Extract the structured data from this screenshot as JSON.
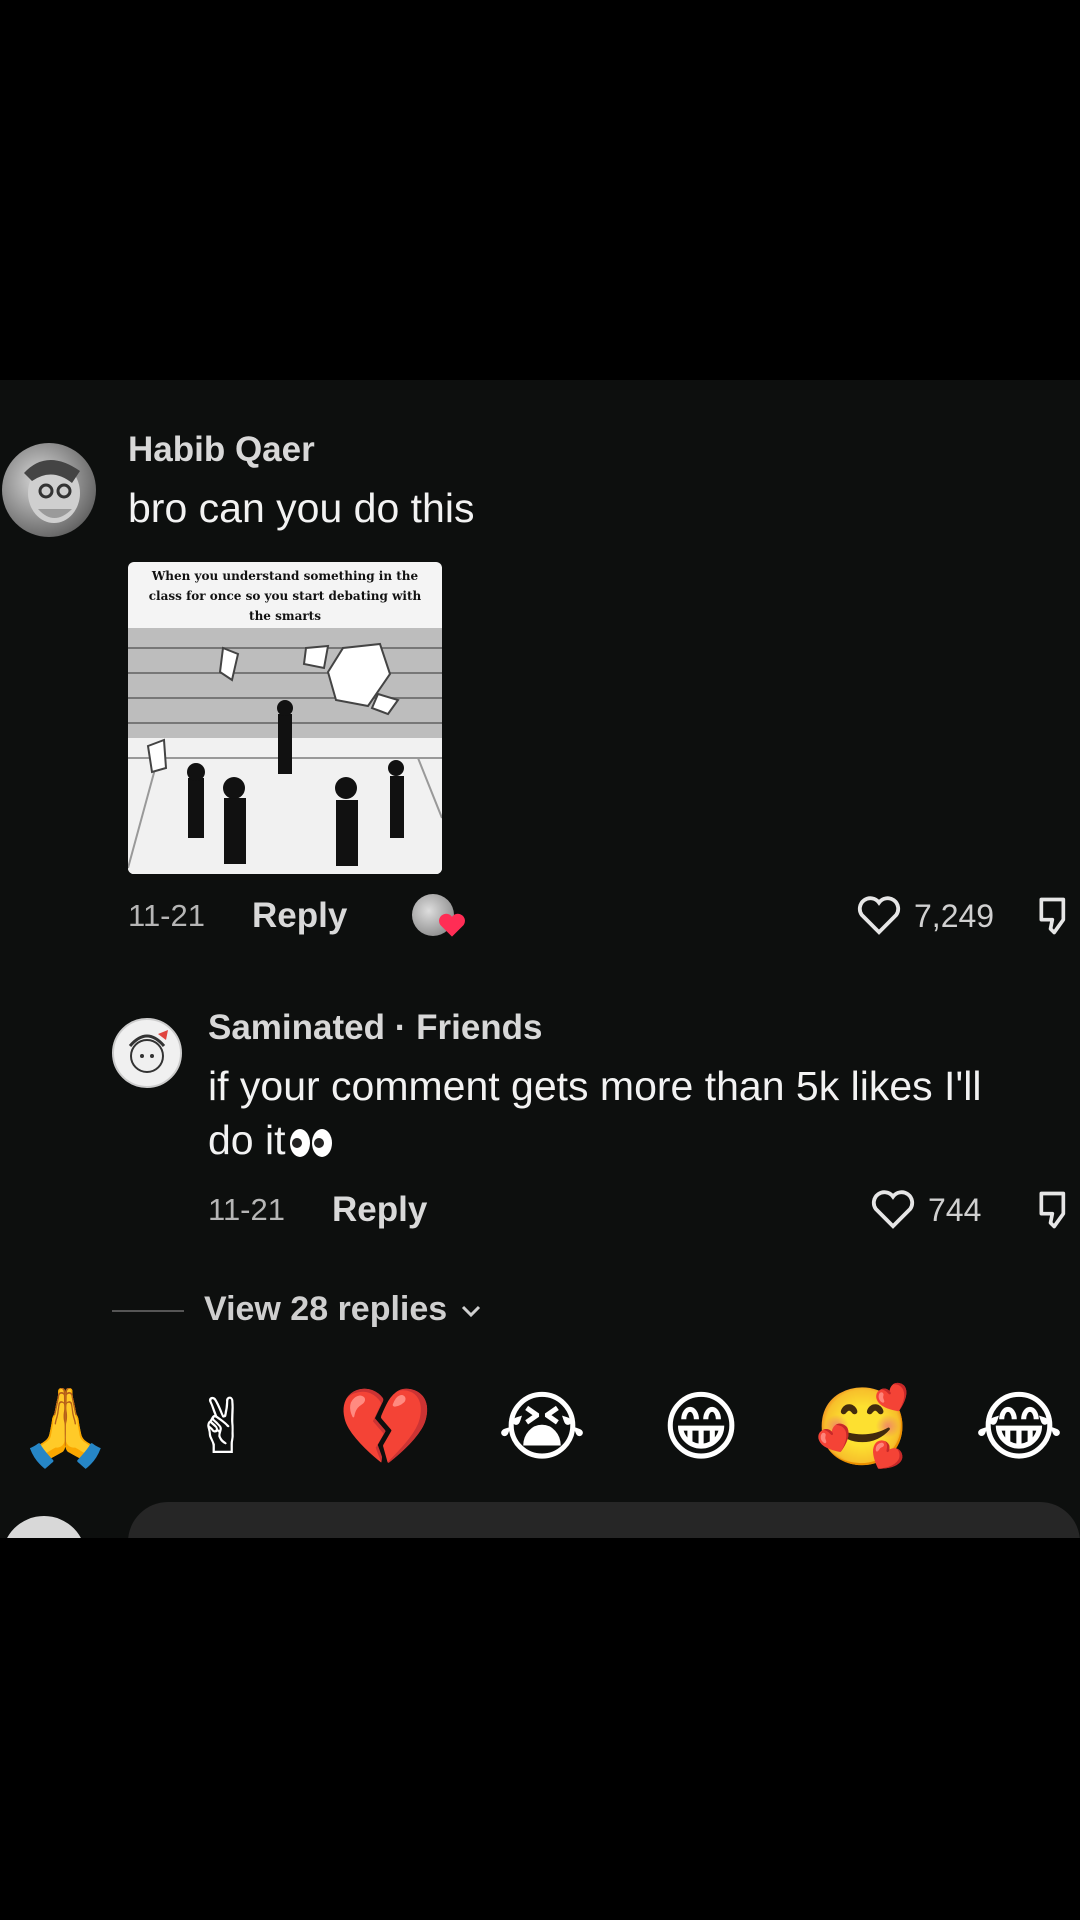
{
  "comment": {
    "author": "Habib Qaer",
    "text": "bro can you do this",
    "image_caption": "When you understand something in the class for once so you start debating with the smarts",
    "date": "11-21",
    "reply_label": "Reply",
    "likes": "7,249"
  },
  "reply_comment": {
    "author": "Saminated · Friends",
    "text_line1": "if your comment gets more than 5k likes I'll",
    "text_line2": "do it",
    "date": "11-21",
    "reply_label": "Reply",
    "likes": "744"
  },
  "view_replies": "View 28 replies",
  "emoji_bar": [
    "🙏",
    "✌",
    "💔",
    "😭",
    "😁",
    "🥰",
    "😂"
  ],
  "icons": {
    "like": "heart-outline-icon",
    "dislike": "thumbs-down-icon",
    "expand": "chevron-down-icon"
  }
}
